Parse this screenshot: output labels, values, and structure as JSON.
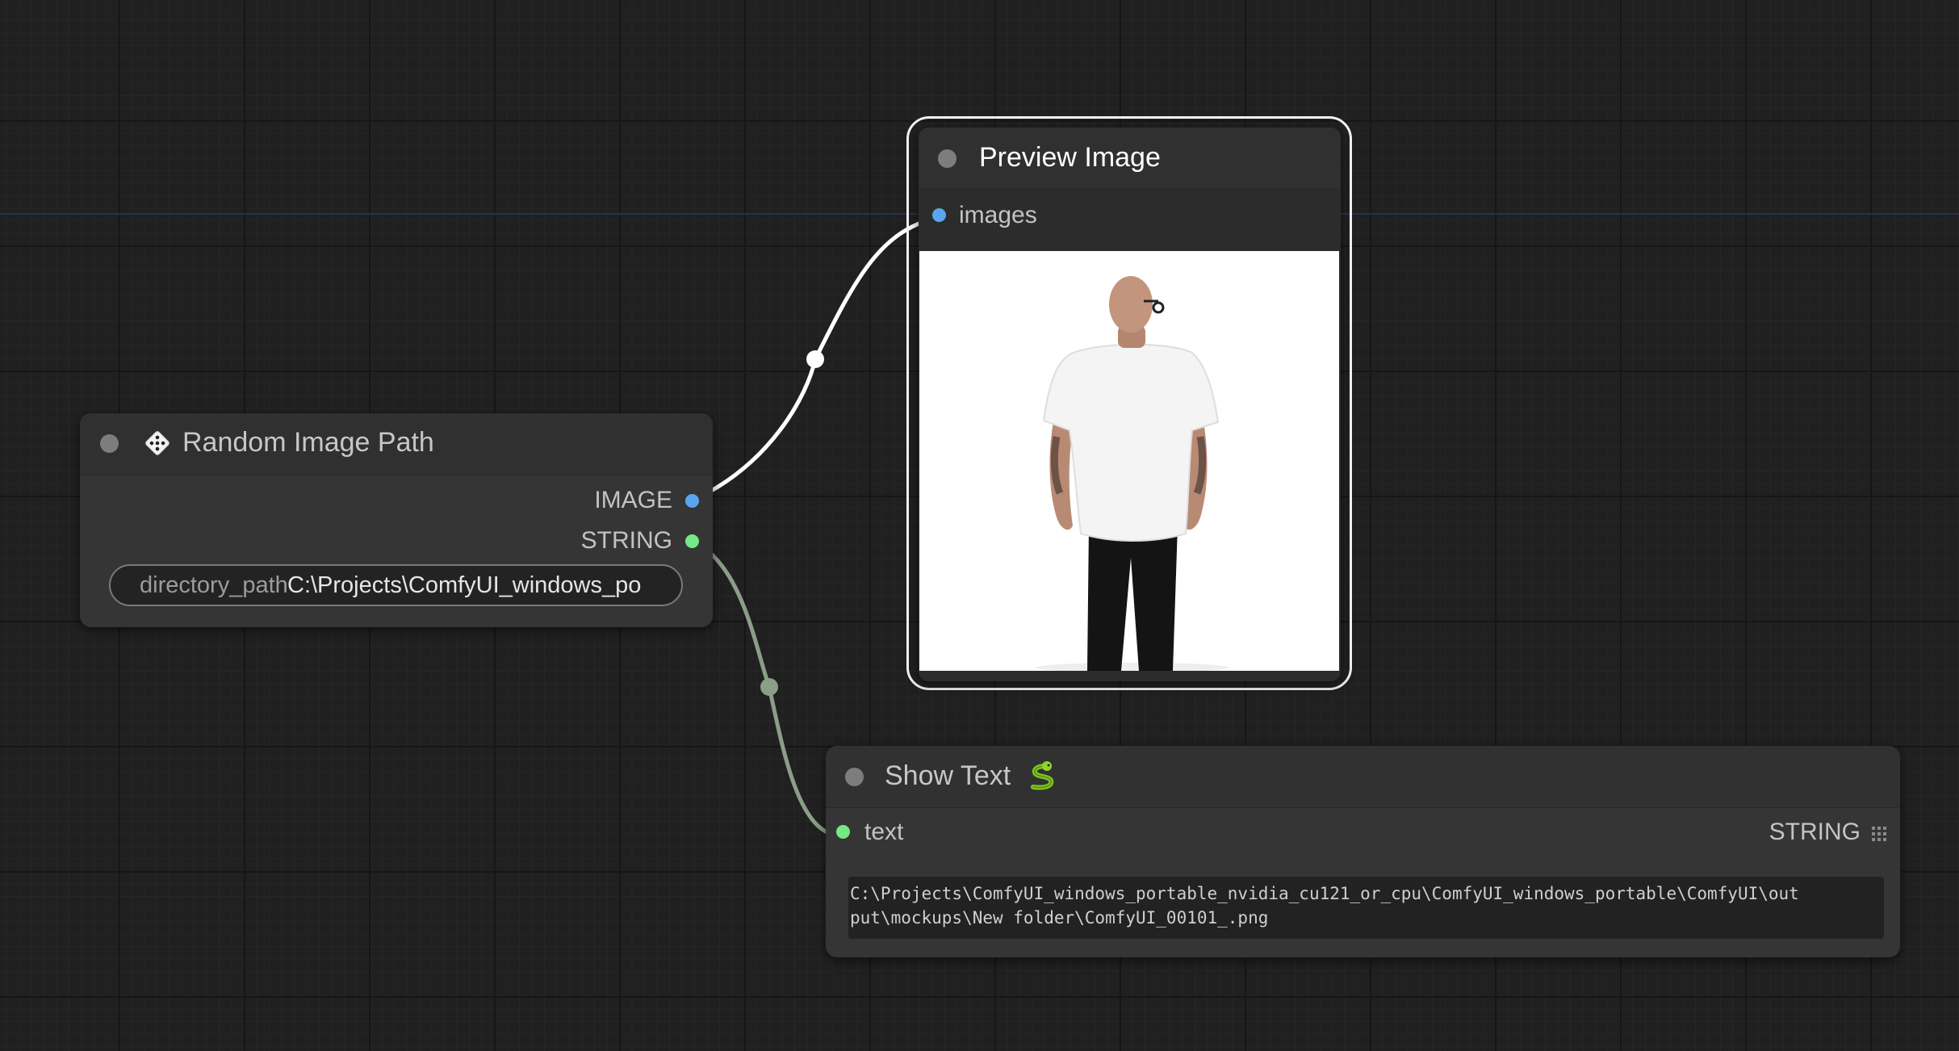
{
  "nodes": {
    "random_image_path": {
      "title": "Random Image Path",
      "outputs": [
        "IMAGE",
        "STRING"
      ],
      "widget": {
        "name": "directory_path",
        "value": "C:\\Projects\\ComfyUI_windows_po"
      }
    },
    "preview_image": {
      "title": "Preview Image",
      "inputs": [
        "images"
      ]
    },
    "show_text": {
      "title": "Show Text",
      "input": "text",
      "output": "STRING",
      "text_lines": [
        "C:\\Projects\\ComfyUI_windows_portable_nvidia_cu121_or_cpu\\ComfyUI_windows_portable\\ComfyUI\\out",
        "put\\mockups\\New folder\\ComfyUI_00101_.png"
      ]
    }
  },
  "colors": {
    "image_slot": "#5aa6ee",
    "string_slot": "#73e884",
    "image_link": "#ffffff",
    "string_link": "#8b9e88",
    "selected_outline": "#f2f2f2"
  },
  "icons": {
    "random_image_path": "dice-icon",
    "show_text": "snake-icon",
    "show_text_output": "grid-icon"
  }
}
